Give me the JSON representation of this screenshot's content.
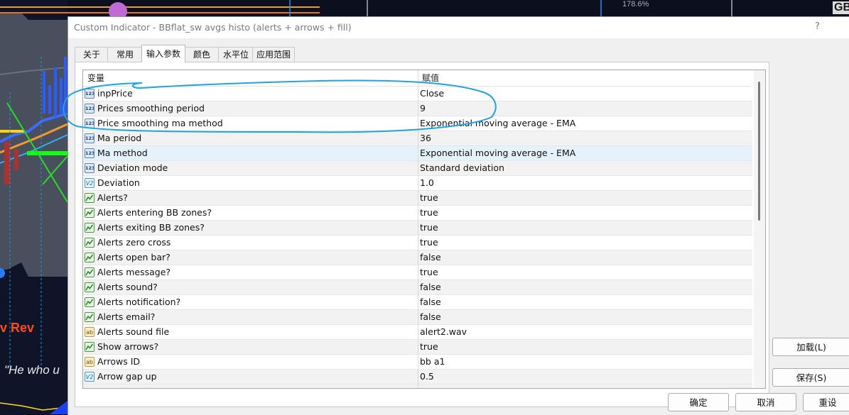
{
  "chart_overlay": {
    "rev_text": "v Rev",
    "quote_text": "\"He who u",
    "percent_text": "178.6%",
    "corner_text": "GB"
  },
  "dialog": {
    "title": "Custom Indicator - BBflat_sw avgs histo (alerts + arrows + fill)",
    "help": "?",
    "tabs": [
      {
        "label": "关于",
        "active": false
      },
      {
        "label": "常用",
        "active": false
      },
      {
        "label": "输入参数",
        "active": true
      },
      {
        "label": "颜色",
        "active": false
      },
      {
        "label": "水平位",
        "active": false
      },
      {
        "label": "应用范围",
        "active": false
      }
    ],
    "table": {
      "col_variable": "变量",
      "col_value": "赋值",
      "rows": [
        {
          "name": "inpPrice",
          "value": "Close",
          "icon": "int-icon",
          "icon_text": "123"
        },
        {
          "name": "Prices smoothing period",
          "value": "9",
          "icon": "int-icon",
          "icon_text": "123"
        },
        {
          "name": "Price smoothing ma method",
          "value": "Exponential moving average - EMA",
          "icon": "int-icon",
          "icon_text": "123"
        },
        {
          "name": "Ma period",
          "value": "36",
          "icon": "int-icon",
          "icon_text": "123"
        },
        {
          "name": "Ma method",
          "value": "Exponential moving average - EMA",
          "icon": "int-icon",
          "icon_text": "123"
        },
        {
          "name": "Deviation mode",
          "value": "Standard deviation",
          "icon": "int-icon",
          "icon_text": "123"
        },
        {
          "name": "Deviation",
          "value": "1.0",
          "icon": "double-icon",
          "icon_text": "V2"
        },
        {
          "name": "Alerts?",
          "value": "true",
          "icon": "bool-icon",
          "icon_text": ""
        },
        {
          "name": "Alerts entering BB zones?",
          "value": "true",
          "icon": "bool-icon",
          "icon_text": ""
        },
        {
          "name": "Alerts exiting BB zones?",
          "value": "true",
          "icon": "bool-icon",
          "icon_text": ""
        },
        {
          "name": "Alerts zero cross",
          "value": "true",
          "icon": "bool-icon",
          "icon_text": ""
        },
        {
          "name": "Alerts open bar?",
          "value": "false",
          "icon": "bool-icon",
          "icon_text": ""
        },
        {
          "name": "Alerts message?",
          "value": "true",
          "icon": "bool-icon",
          "icon_text": ""
        },
        {
          "name": "Alerts sound?",
          "value": "false",
          "icon": "bool-icon",
          "icon_text": ""
        },
        {
          "name": "Alerts notification?",
          "value": "false",
          "icon": "bool-icon",
          "icon_text": ""
        },
        {
          "name": "Alerts email?",
          "value": "false",
          "icon": "bool-icon",
          "icon_text": ""
        },
        {
          "name": "Alerts sound file",
          "value": "alert2.wav",
          "icon": "string-icon",
          "icon_text": "ab"
        },
        {
          "name": "Show arrows?",
          "value": "true",
          "icon": "bool-icon",
          "icon_text": ""
        },
        {
          "name": "Arrows ID",
          "value": "bb a1",
          "icon": "string-icon",
          "icon_text": "ab"
        },
        {
          "name": "Arrow gap up",
          "value": "0.5",
          "icon": "double-icon",
          "icon_text": "V2"
        }
      ]
    },
    "buttons": {
      "load": "加载(L)",
      "save": "保存(S)",
      "ok": "确定",
      "cancel": "取消",
      "reset": "重设"
    }
  }
}
